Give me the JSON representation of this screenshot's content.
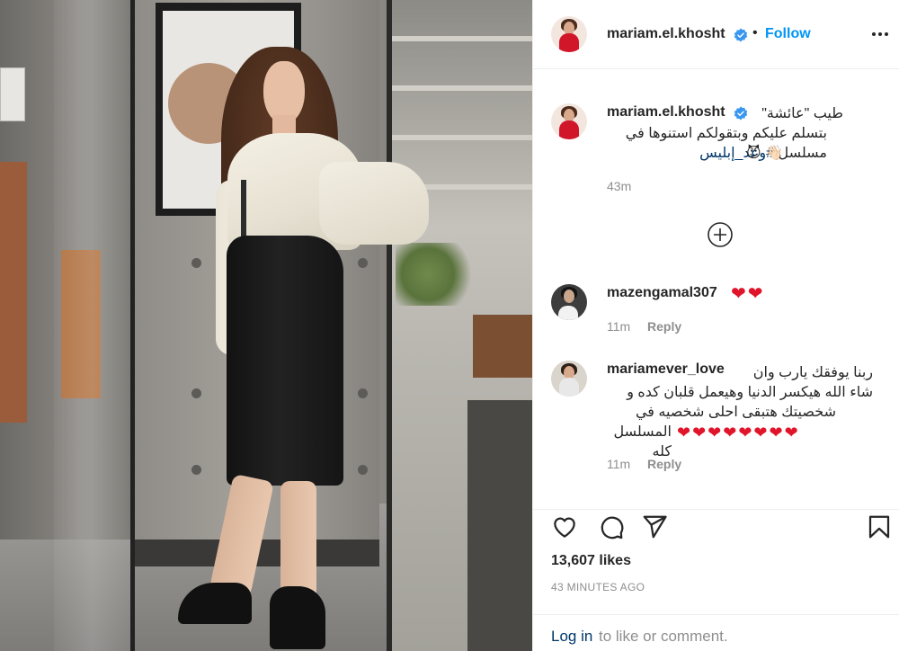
{
  "post": {
    "author": "mariam.el.khosht",
    "follow_label": "Follow",
    "separator": "•",
    "likes": "13,607 likes",
    "posted": "43 MINUTES AGO"
  },
  "caption": {
    "username": "mariam.el.khosht",
    "line1": "طيب \"عائشة\"",
    "line2": "بتسلم عليكم وبتقولكم استنوها في",
    "line3_text": "مسلسل",
    "hashtag": "#وعد_إبليس",
    "emoji": "😈 👋🏻",
    "time": "43m"
  },
  "comments": [
    {
      "username": "mazengamal307",
      "hearts": "❤❤",
      "time": "11m",
      "reply_label": "Reply"
    },
    {
      "username": "mariamever_love",
      "line1": "ربنا يوفقك يارب وان",
      "line2": "شاء الله هيكسر الدنيا وهيعمل قلبان كده و",
      "line3": "شخصيتك هتبقى احلى شخصيه في",
      "line4": "المسلسل كله",
      "hearts": "❤❤❤❤❤❤❤❤",
      "time": "11m",
      "reply_label": "Reply"
    }
  ],
  "footer": {
    "login_link": "Log in",
    "login_rest": "to like or comment."
  },
  "colors": {
    "link_blue": "#0095f6",
    "verified_blue": "#3897f0",
    "heart_red": "#e0142a",
    "muted": "#8e8e8e"
  },
  "icons": [
    "more-options-icon",
    "verified-badge-icon",
    "load-more-icon",
    "heart-icon",
    "comment-icon",
    "share-icon",
    "bookmark-icon"
  ]
}
